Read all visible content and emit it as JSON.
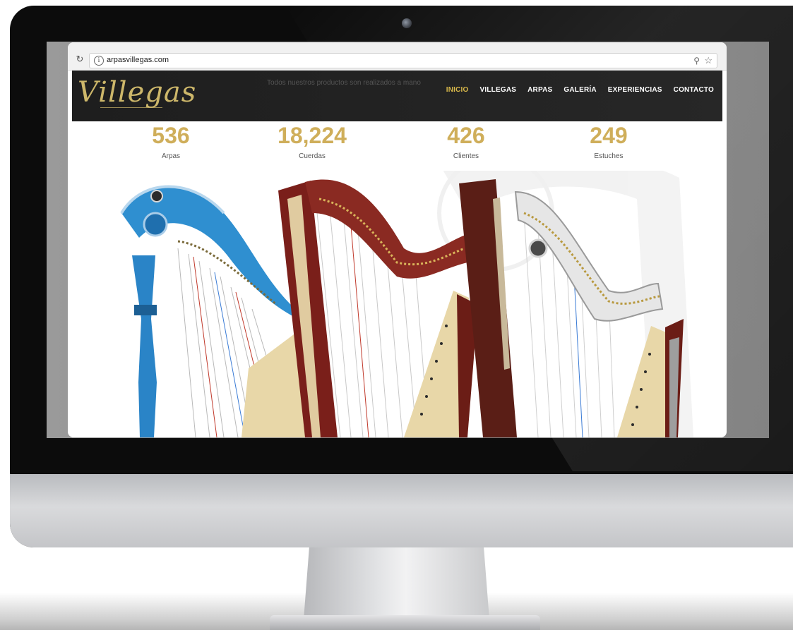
{
  "browser": {
    "url": "arpasvillegas.com"
  },
  "site": {
    "logo_text": "Villegas",
    "tagline": "Todos nuestros productos son realizados a mano",
    "nav": [
      {
        "label": "INICIO",
        "active": true
      },
      {
        "label": "VILLEGAS",
        "active": false
      },
      {
        "label": "ARPAS",
        "active": false
      },
      {
        "label": "GALERÍA",
        "active": false
      },
      {
        "label": "EXPERIENCIAS",
        "active": false
      },
      {
        "label": "CONTACTO",
        "active": false
      }
    ]
  },
  "stats": [
    {
      "value": "536",
      "label": "Arpas"
    },
    {
      "value": "18,224",
      "label": "Cuerdas"
    },
    {
      "value": "426",
      "label": "Clientes"
    },
    {
      "value": "249",
      "label": "Estuches"
    }
  ],
  "colors": {
    "gold": "#cfae5a",
    "active_nav": "#d8b84a",
    "header_bg": "#1e1e1e",
    "harp_blue": "#2f8fd0",
    "harp_red": "#7a1f1a",
    "harp_wood": "#5a1e16",
    "soundboard": "#e8d7a8"
  },
  "icons": {
    "reload": "reload-icon",
    "info": "info-icon",
    "zoom": "zoom-icon",
    "bookmark": "star-icon"
  }
}
